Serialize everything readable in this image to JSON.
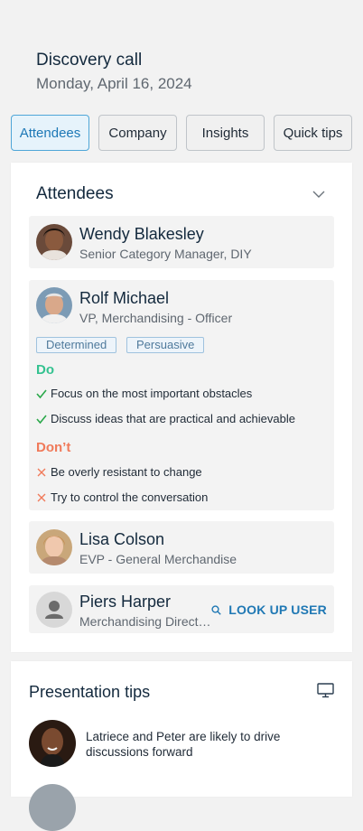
{
  "meeting": {
    "title": "Discovery call",
    "date": "Monday, April 16, 2024"
  },
  "tabs": [
    {
      "label": "Attendees",
      "active": true
    },
    {
      "label": "Company"
    },
    {
      "label": "Insights"
    },
    {
      "label": "Quick tips"
    }
  ],
  "attendees": {
    "title": "Attendees",
    "people": [
      {
        "name": "Wendy Blakesley",
        "role": "Senior Category Manager, DIY"
      },
      {
        "name": "Rolf Michael",
        "role": "VP, Merchandising - Officer",
        "tags": [
          "Determined",
          "Persuasive"
        ],
        "do_label": "Do",
        "do": [
          "Focus on the most important obstacles",
          "Discuss ideas that are practical and achievable"
        ],
        "dont_label": "Don’t",
        "dont": [
          "Be overly resistant to change",
          "Try to control the conversation"
        ]
      },
      {
        "name": "Lisa Colson",
        "role": "EVP - General Merchandise"
      },
      {
        "name": "Piers Harper",
        "role": "Merchandising Direct…",
        "action": "LOOK UP USER"
      }
    ]
  },
  "presentation": {
    "title": "Presentation tips",
    "tips": [
      {
        "text": "Latriece and Peter are likely to drive discussions forward"
      }
    ]
  },
  "colors": {
    "accent": "#1f78b4",
    "do": "#34c290",
    "dont": "#f07a5a"
  }
}
